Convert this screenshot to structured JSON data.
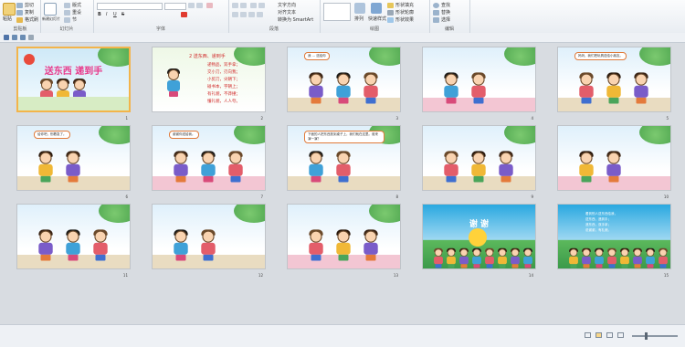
{
  "ribbon": {
    "groups": [
      {
        "id": "clipboard",
        "label": "剪贴板",
        "items": [
          "粘贴",
          "剪切",
          "复制",
          "格式刷"
        ]
      },
      {
        "id": "slides",
        "label": "幻灯片",
        "items": [
          "新建幻灯片",
          "版式",
          "重设",
          "节"
        ]
      },
      {
        "id": "font",
        "label": "字体",
        "items": []
      },
      {
        "id": "paragraph",
        "label": "段落",
        "items": [
          "文字方向",
          "对齐文本",
          "转换为 SmartArt"
        ]
      },
      {
        "id": "drawing",
        "label": "绘图",
        "items": [
          "排列",
          "快速样式",
          "形状填充",
          "形状轮廓",
          "形状效果"
        ]
      },
      {
        "id": "editing",
        "label": "编辑",
        "items": [
          "查找",
          "替换",
          "选择"
        ]
      }
    ]
  },
  "slides": [
    {
      "num": "1",
      "sub": "",
      "title": "送东西 递到手",
      "kind": "title"
    },
    {
      "num": "2",
      "sub": "",
      "title": "2 送东西、递到手",
      "kind": "text",
      "lines": [
        "递物品，双手拿；",
        "交小刀，刃向我；",
        "小剪刀，尖朝下；",
        "碰书本，字朝上；",
        "有礼貌，不莽撞；",
        "懂礼貌，人人夸。"
      ]
    },
    {
      "num": "3",
      "sub": "",
      "title": "",
      "kind": "scene",
      "bubble": "我 … 送给你"
    },
    {
      "num": "4",
      "sub": "",
      "title": "",
      "kind": "scene",
      "bubble": ""
    },
    {
      "num": "5",
      "sub": "",
      "title": "",
      "kind": "scene",
      "bubble": "妈妈，我们把玩具送给小朋友。"
    },
    {
      "num": "6",
      "sub": "",
      "title": "",
      "kind": "scene",
      "bubble": "给你吧，别着急了。"
    },
    {
      "num": "7",
      "sub": "",
      "title": "",
      "kind": "scene",
      "bubble": "谢谢你送给我。"
    },
    {
      "num": "8",
      "sub": "",
      "title": "",
      "kind": "scene",
      "bubble": "下面的人把东西放到桌子上，我们就在这里。谁来演一演？"
    },
    {
      "num": "9",
      "sub": "",
      "title": "",
      "kind": "scene",
      "bubble": ""
    },
    {
      "num": "10",
      "sub": "",
      "title": "",
      "kind": "scene",
      "bubble": ""
    },
    {
      "num": "11",
      "sub": "",
      "title": "",
      "kind": "scene",
      "bubble": ""
    },
    {
      "num": "12",
      "sub": "",
      "title": "",
      "kind": "scene",
      "bubble": ""
    },
    {
      "num": "13",
      "sub": "",
      "title": "",
      "kind": "scene",
      "bubble": ""
    },
    {
      "num": "14",
      "sub": "",
      "title": "谢 谢",
      "kind": "end"
    },
    {
      "num": "15",
      "sub": "",
      "title": "",
      "kind": "end2",
      "lines": [
        "看到别人送东西给我，",
        "送东西、递到手；",
        "递东西，双手拿；",
        "说谢谢，有礼貌。"
      ]
    }
  ],
  "colors": {
    "selected": "#f3b44a",
    "ribbon": "#eef1f5",
    "workspace": "#d8dce1"
  }
}
